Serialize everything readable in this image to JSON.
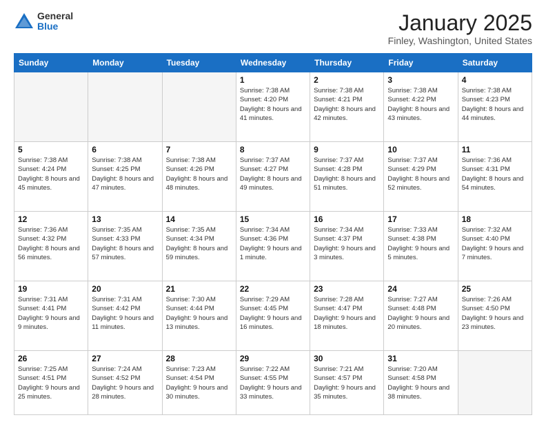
{
  "logo": {
    "general": "General",
    "blue": "Blue"
  },
  "title": "January 2025",
  "subtitle": "Finley, Washington, United States",
  "days_header": [
    "Sunday",
    "Monday",
    "Tuesday",
    "Wednesday",
    "Thursday",
    "Friday",
    "Saturday"
  ],
  "weeks": [
    [
      {
        "day": "",
        "detail": ""
      },
      {
        "day": "",
        "detail": ""
      },
      {
        "day": "",
        "detail": ""
      },
      {
        "day": "1",
        "detail": "Sunrise: 7:38 AM\nSunset: 4:20 PM\nDaylight: 8 hours and 41 minutes."
      },
      {
        "day": "2",
        "detail": "Sunrise: 7:38 AM\nSunset: 4:21 PM\nDaylight: 8 hours and 42 minutes."
      },
      {
        "day": "3",
        "detail": "Sunrise: 7:38 AM\nSunset: 4:22 PM\nDaylight: 8 hours and 43 minutes."
      },
      {
        "day": "4",
        "detail": "Sunrise: 7:38 AM\nSunset: 4:23 PM\nDaylight: 8 hours and 44 minutes."
      }
    ],
    [
      {
        "day": "5",
        "detail": "Sunrise: 7:38 AM\nSunset: 4:24 PM\nDaylight: 8 hours and 45 minutes."
      },
      {
        "day": "6",
        "detail": "Sunrise: 7:38 AM\nSunset: 4:25 PM\nDaylight: 8 hours and 47 minutes."
      },
      {
        "day": "7",
        "detail": "Sunrise: 7:38 AM\nSunset: 4:26 PM\nDaylight: 8 hours and 48 minutes."
      },
      {
        "day": "8",
        "detail": "Sunrise: 7:37 AM\nSunset: 4:27 PM\nDaylight: 8 hours and 49 minutes."
      },
      {
        "day": "9",
        "detail": "Sunrise: 7:37 AM\nSunset: 4:28 PM\nDaylight: 8 hours and 51 minutes."
      },
      {
        "day": "10",
        "detail": "Sunrise: 7:37 AM\nSunset: 4:29 PM\nDaylight: 8 hours and 52 minutes."
      },
      {
        "day": "11",
        "detail": "Sunrise: 7:36 AM\nSunset: 4:31 PM\nDaylight: 8 hours and 54 minutes."
      }
    ],
    [
      {
        "day": "12",
        "detail": "Sunrise: 7:36 AM\nSunset: 4:32 PM\nDaylight: 8 hours and 56 minutes."
      },
      {
        "day": "13",
        "detail": "Sunrise: 7:35 AM\nSunset: 4:33 PM\nDaylight: 8 hours and 57 minutes."
      },
      {
        "day": "14",
        "detail": "Sunrise: 7:35 AM\nSunset: 4:34 PM\nDaylight: 8 hours and 59 minutes."
      },
      {
        "day": "15",
        "detail": "Sunrise: 7:34 AM\nSunset: 4:36 PM\nDaylight: 9 hours and 1 minute."
      },
      {
        "day": "16",
        "detail": "Sunrise: 7:34 AM\nSunset: 4:37 PM\nDaylight: 9 hours and 3 minutes."
      },
      {
        "day": "17",
        "detail": "Sunrise: 7:33 AM\nSunset: 4:38 PM\nDaylight: 9 hours and 5 minutes."
      },
      {
        "day": "18",
        "detail": "Sunrise: 7:32 AM\nSunset: 4:40 PM\nDaylight: 9 hours and 7 minutes."
      }
    ],
    [
      {
        "day": "19",
        "detail": "Sunrise: 7:31 AM\nSunset: 4:41 PM\nDaylight: 9 hours and 9 minutes."
      },
      {
        "day": "20",
        "detail": "Sunrise: 7:31 AM\nSunset: 4:42 PM\nDaylight: 9 hours and 11 minutes."
      },
      {
        "day": "21",
        "detail": "Sunrise: 7:30 AM\nSunset: 4:44 PM\nDaylight: 9 hours and 13 minutes."
      },
      {
        "day": "22",
        "detail": "Sunrise: 7:29 AM\nSunset: 4:45 PM\nDaylight: 9 hours and 16 minutes."
      },
      {
        "day": "23",
        "detail": "Sunrise: 7:28 AM\nSunset: 4:47 PM\nDaylight: 9 hours and 18 minutes."
      },
      {
        "day": "24",
        "detail": "Sunrise: 7:27 AM\nSunset: 4:48 PM\nDaylight: 9 hours and 20 minutes."
      },
      {
        "day": "25",
        "detail": "Sunrise: 7:26 AM\nSunset: 4:50 PM\nDaylight: 9 hours and 23 minutes."
      }
    ],
    [
      {
        "day": "26",
        "detail": "Sunrise: 7:25 AM\nSunset: 4:51 PM\nDaylight: 9 hours and 25 minutes."
      },
      {
        "day": "27",
        "detail": "Sunrise: 7:24 AM\nSunset: 4:52 PM\nDaylight: 9 hours and 28 minutes."
      },
      {
        "day": "28",
        "detail": "Sunrise: 7:23 AM\nSunset: 4:54 PM\nDaylight: 9 hours and 30 minutes."
      },
      {
        "day": "29",
        "detail": "Sunrise: 7:22 AM\nSunset: 4:55 PM\nDaylight: 9 hours and 33 minutes."
      },
      {
        "day": "30",
        "detail": "Sunrise: 7:21 AM\nSunset: 4:57 PM\nDaylight: 9 hours and 35 minutes."
      },
      {
        "day": "31",
        "detail": "Sunrise: 7:20 AM\nSunset: 4:58 PM\nDaylight: 9 hours and 38 minutes."
      },
      {
        "day": "",
        "detail": ""
      }
    ]
  ]
}
